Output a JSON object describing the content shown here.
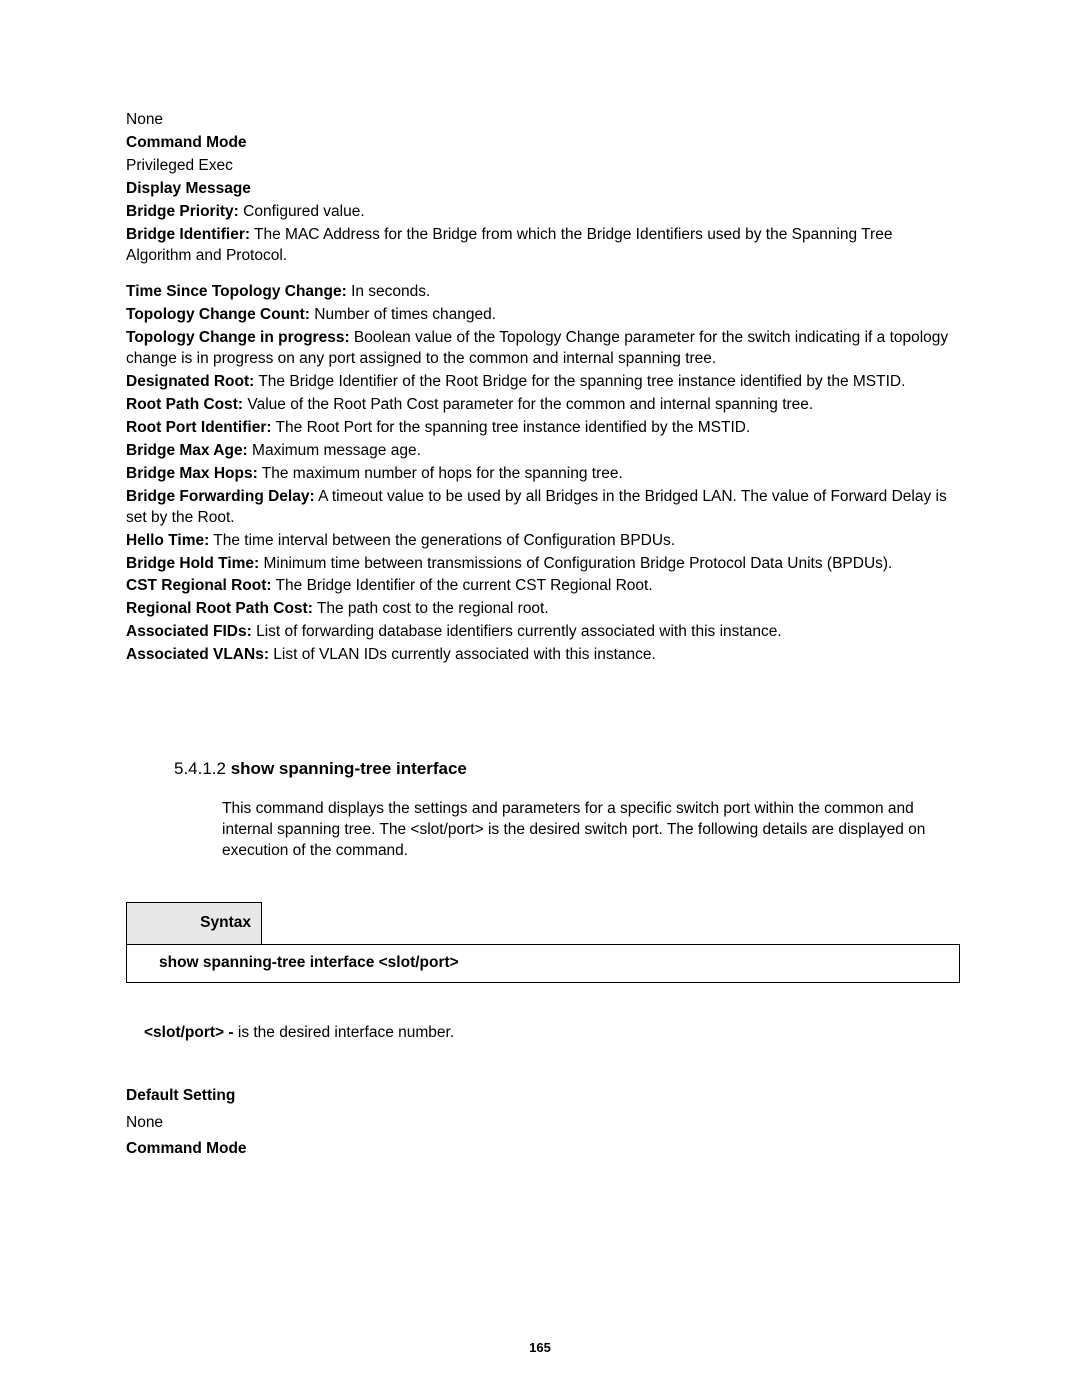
{
  "top": {
    "none": "None",
    "command_mode_label": "Command Mode",
    "command_mode_value": "Privileged Exec",
    "display_message_label": "Display Message"
  },
  "defs": {
    "bridge_priority": {
      "label": "Bridge Priority:",
      "text": " Configured value."
    },
    "bridge_identifier": {
      "label": "Bridge Identifier:",
      "text": " The MAC Address for the Bridge from which the Bridge Identifiers used by the Spanning Tree Algorithm and Protocol."
    },
    "time_since_topology_change": {
      "label": "Time Since Topology Change:",
      "text": " In seconds."
    },
    "topology_change_count": {
      "label": "Topology Change Count:",
      "text": " Number of times changed."
    },
    "topology_change_in_progress": {
      "label": "Topology Change in progress:",
      "text": " Boolean value of the Topology Change parameter for the switch indicating if a topology change is in progress on any port assigned to the common and internal spanning tree."
    },
    "designated_root": {
      "label": "Designated Root:",
      "text": " The Bridge Identifier of the Root Bridge for the spanning tree instance identified by the MSTID."
    },
    "root_path_cost": {
      "label": "Root Path Cost:",
      "text": " Value of the Root Path Cost parameter for the common and internal spanning tree."
    },
    "root_port_identifier": {
      "label": "Root Port Identifier:",
      "text": " The Root Port for the spanning tree instance identified by the MSTID."
    },
    "bridge_max_age": {
      "label": "Bridge Max Age:",
      "text": " Maximum message age."
    },
    "bridge_max_hops": {
      "label": "Bridge Max Hops:",
      "text": " The maximum number of hops for the spanning tree."
    },
    "bridge_forwarding_delay": {
      "label": "Bridge Forwarding Delay:",
      "text": " A timeout value to be used by all Bridges in the Bridged LAN. The value of Forward Delay is set by the Root."
    },
    "hello_time": {
      "label": "Hello Time:",
      "text": " The time interval between the generations of Configuration BPDUs."
    },
    "bridge_hold_time": {
      "label": "Bridge Hold Time:",
      "text": " Minimum time between transmissions of Configuration Bridge Protocol Data Units (BPDUs)."
    },
    "cst_regional_root": {
      "label": "CST Regional Root:",
      "text": " The Bridge Identifier of the current CST Regional Root."
    },
    "regional_root_path_cost": {
      "label": "Regional Root Path Cost:",
      "text": " The path cost to the regional root."
    },
    "associated_fids": {
      "label": "Associated FIDs:",
      "text": " List of forwarding database identifiers currently associated with this instance."
    },
    "associated_vlans": {
      "label": "Associated VLANs:",
      "text": " List of VLAN IDs currently associated with this instance."
    }
  },
  "section": {
    "number": "5.4.1.2 ",
    "title": "show spanning-tree interface",
    "description": "This command displays the settings and parameters for a specific switch port within the common and internal spanning tree. The <slot/port> is the desired switch port. The following details are displayed on execution of the command."
  },
  "syntax": {
    "label": "Syntax",
    "command": "show spanning-tree interface <slot/port>"
  },
  "param": {
    "label": "<slot/port> - ",
    "text": "is the desired interface number."
  },
  "bottom": {
    "default_setting_label": "Default Setting",
    "default_setting_value": "None",
    "command_mode_label": "Command Mode"
  },
  "page_number": "165"
}
